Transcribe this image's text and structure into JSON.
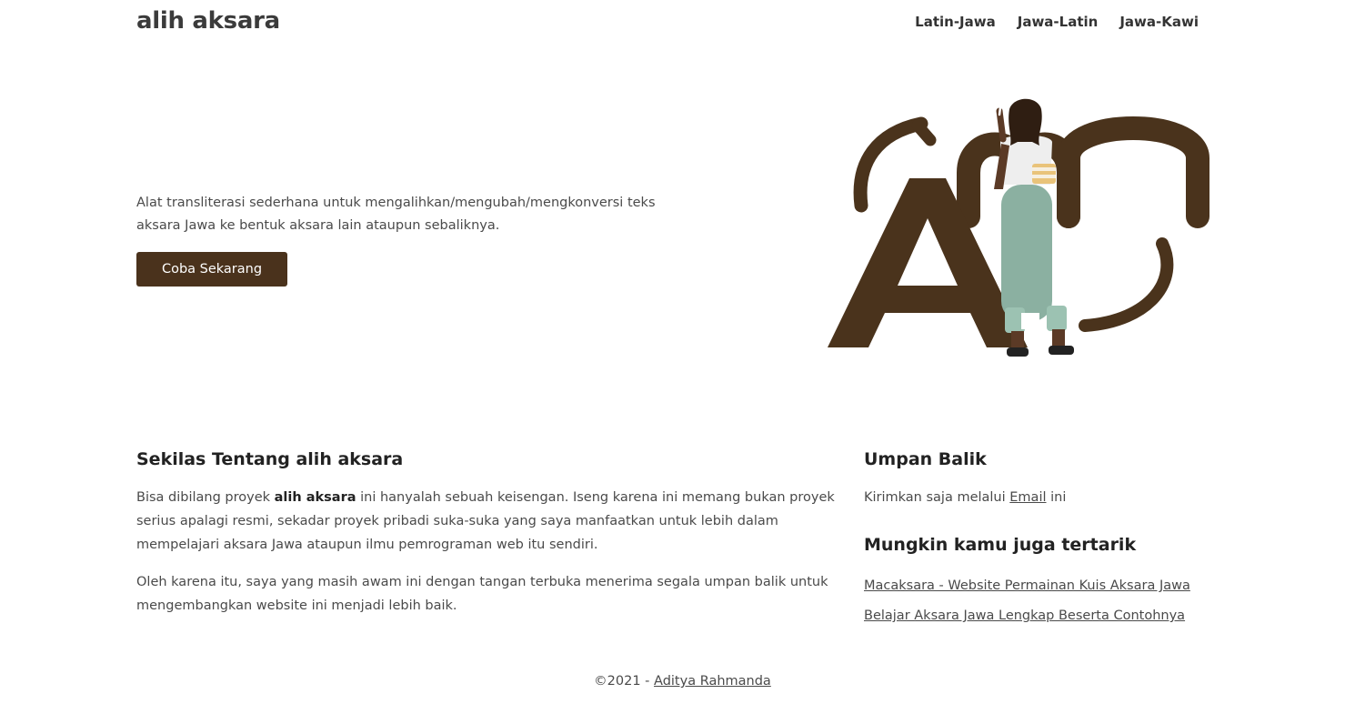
{
  "header": {
    "brand": "alih aksara",
    "nav": [
      "Latin-Jawa",
      "Jawa-Latin",
      "Jawa-Kawi"
    ]
  },
  "hero": {
    "description": "Alat transliterasi sederhana untuk mengalihkan/mengubah/mengkonversi teks aksara Jawa ke bentuk aksara lain ataupun sebaliknya.",
    "cta_label": "Coba Sekarang"
  },
  "about": {
    "title": "Sekilas Tentang alih aksara",
    "p1_before": "Bisa dibilang proyek ",
    "p1_bold": "alih aksara",
    "p1_after": " ini hanyalah sebuah keisengan. Iseng karena ini memang bukan proyek serius apalagi resmi, sekadar proyek pribadi suka-suka yang saya manfaatkan untuk lebih dalam mempelajari aksara Jawa ataupun ilmu pemrograman web itu sendiri.",
    "p2": "Oleh karena itu, saya yang masih awam ini dengan tangan terbuka menerima segala umpan balik untuk mengembangkan website ini menjadi lebih baik."
  },
  "feedback": {
    "title": "Umpan Balik",
    "text_before": "Kirimkan saja melalui ",
    "link": "Email",
    "text_after": " ini"
  },
  "related": {
    "title": "Mungkin kamu juga tertarik",
    "links": [
      "Macaksara - Website Permainan Kuis Aksara Jawa",
      "Belajar Aksara Jawa Lengkap Beserta Contohnya"
    ]
  },
  "footer": {
    "copyright": "©2021 - ",
    "author": "Aditya Rahmanda"
  },
  "colors": {
    "brand_brown": "#4a321c",
    "illustration_brown": "#4a331c",
    "pants": "#8bb0a1"
  }
}
